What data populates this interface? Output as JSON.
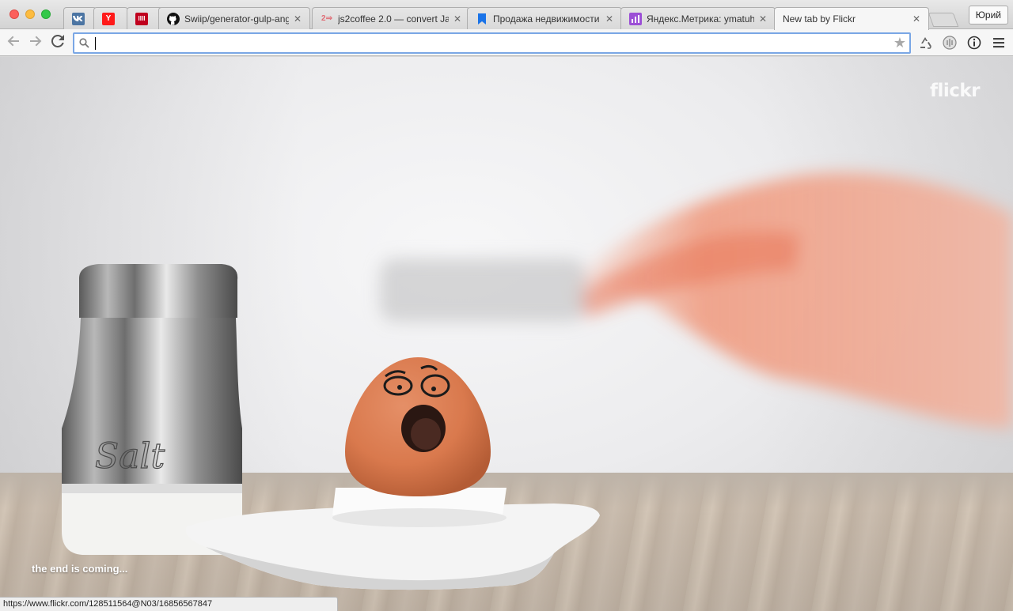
{
  "window": {
    "profile_name": "Юрий"
  },
  "tabs": [
    {
      "title": "",
      "favicon": "vk-icon",
      "color": "#4c75a3",
      "glyph": "vk"
    },
    {
      "title": "",
      "favicon": "yandex-icon",
      "color": "#ff0000",
      "glyph": "Y"
    },
    {
      "title": "",
      "favicon": "habr-icon",
      "color": "#c0001e",
      "glyph": "IIII"
    },
    {
      "title": "Swiip/generator-gulp-angu",
      "favicon": "github-icon",
      "color": "#111111",
      "glyph": "●"
    },
    {
      "title": "js2coffee 2.0 — convert Ja",
      "favicon": "js2coffee-icon",
      "color": "#e06c75",
      "glyph": "2⇒"
    },
    {
      "title": "Продажа недвижимости",
      "favicon": "bookmark-icon",
      "color": "#1a73e8",
      "glyph": "▮"
    },
    {
      "title": "Яндекс.Метрика: ymatuhi",
      "favicon": "metrika-icon",
      "color": "#9c4fd6",
      "glyph": "▥"
    },
    {
      "title": "New tab by Flickr",
      "favicon": "",
      "color": "",
      "glyph": "",
      "active": true
    }
  ],
  "toolbar": {
    "omnibox_value": "",
    "extensions": [
      "recycle-icon",
      "shield-extension-icon",
      "info-icon",
      "menu-icon"
    ]
  },
  "page": {
    "logo_text": "flickr",
    "photo_caption": "the end is coming...",
    "photo_subject": "egg-in-cup-salt-shaker-spoon"
  },
  "status_bar": {
    "url": "https://www.flickr.com/128511564@N03/16856567847"
  },
  "colors": {
    "omnibox_focus": "#7aa7e5",
    "tab_active": "#f6f6f6"
  }
}
